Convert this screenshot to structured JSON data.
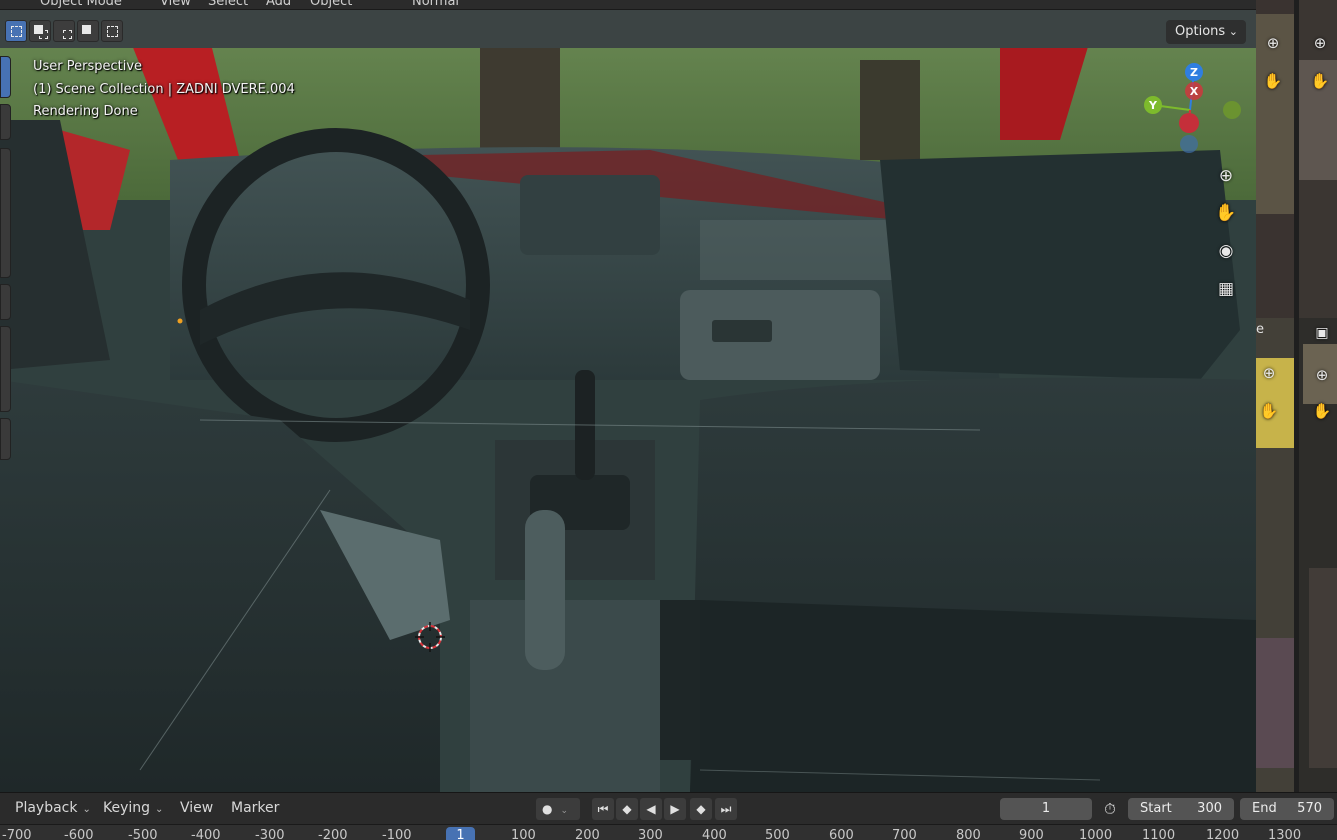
{
  "header": {
    "mode": "Object Mode",
    "menus": [
      "View",
      "Select",
      "Add",
      "Object"
    ],
    "orientation": "Normal"
  },
  "viewport": {
    "options_label": "Options",
    "overlay": {
      "perspective": "User Perspective",
      "collection": "(1) Scene Collection | ZADNI DVERE.004",
      "status": "Rendering Done"
    },
    "gizmo": {
      "axis_z": "Z",
      "axis_y": "Y",
      "axis_x": "X"
    },
    "nav_icons": [
      "zoom-icon",
      "hand-icon",
      "camera-icon",
      "grid-icon"
    ]
  },
  "timeline": {
    "menus": {
      "playback": "Playback",
      "keying": "Keying",
      "view": "View",
      "marker": "Marker"
    },
    "current_frame": "1",
    "start_label": "Start",
    "start_value": "300",
    "end_label": "End",
    "end_value": "570",
    "ruler_ticks": [
      "-700",
      "-600",
      "-500",
      "-400",
      "-300",
      "-200",
      "-100",
      "1",
      "100",
      "200",
      "300",
      "400",
      "500",
      "600",
      "700",
      "800",
      "900",
      "1000",
      "1100",
      "1200",
      "1300"
    ]
  },
  "right_panels": {
    "partial_label": "e"
  },
  "colors": {
    "accent": "#4772b3",
    "axis_z": "#2f7ee0",
    "axis_y": "#7dba2c",
    "axis_x": "#d5333d"
  }
}
